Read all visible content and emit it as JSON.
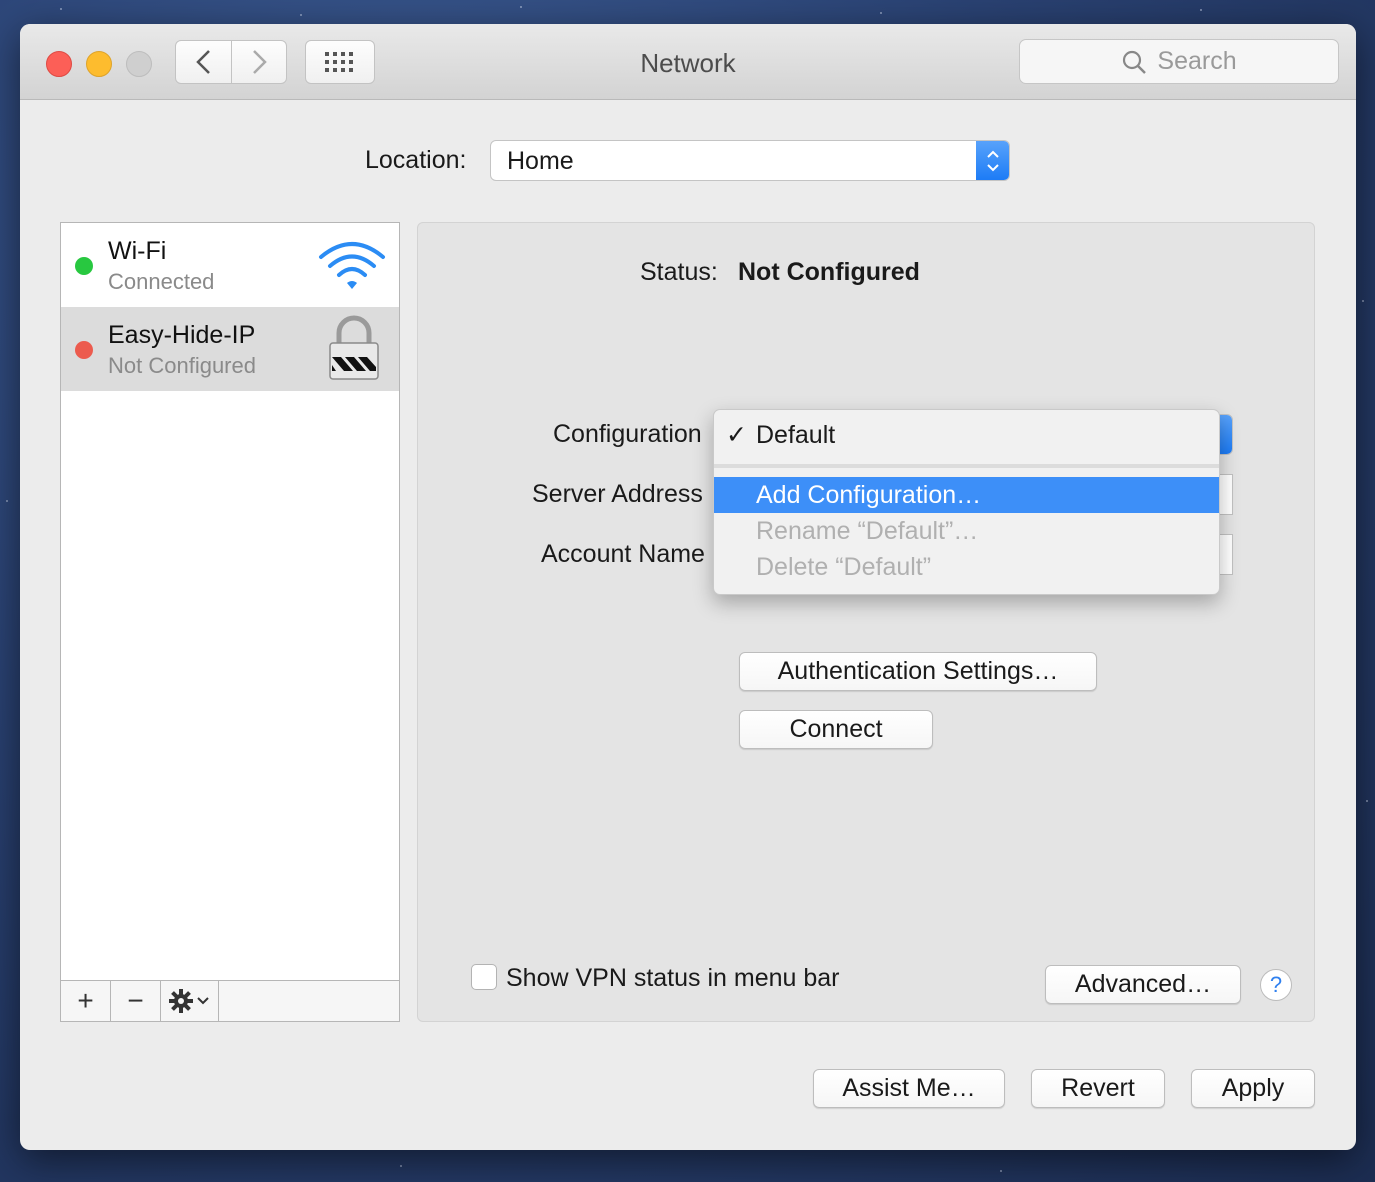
{
  "window": {
    "title": "Network"
  },
  "search": {
    "placeholder": "Search"
  },
  "location": {
    "label": "Location:",
    "value": "Home"
  },
  "services": [
    {
      "name": "Wi-Fi",
      "status": "Connected",
      "status_color": "#28c840",
      "icon": "wifi-icon"
    },
    {
      "name": "Easy-Hide-IP",
      "status": "Not Configured",
      "status_color": "#ec5b4e",
      "icon": "vpn-lock-icon",
      "selected": true
    }
  ],
  "sidebar_toolbar": {
    "add": "+",
    "remove": "−",
    "action_icon": "gear-icon"
  },
  "status": {
    "label": "Status:",
    "value": "Not Configured"
  },
  "form": {
    "configuration_label": "Configuration",
    "server_address_label": "Server Address",
    "account_name_label": "Account Name"
  },
  "config_menu": {
    "items": [
      {
        "label": "Default",
        "checked": true
      },
      {
        "label": "Add Configuration…",
        "highlighted": true
      },
      {
        "label": "Rename “Default”…",
        "disabled": true
      },
      {
        "label": "Delete “Default”",
        "disabled": true
      }
    ]
  },
  "buttons": {
    "authentication": "Authentication Settings…",
    "connect": "Connect",
    "advanced": "Advanced…",
    "help": "?",
    "assist": "Assist Me…",
    "revert": "Revert",
    "apply": "Apply"
  },
  "show_vpn_status": {
    "label": "Show VPN status in menu bar",
    "checked": false
  },
  "accent_color": "#3d8ff8"
}
